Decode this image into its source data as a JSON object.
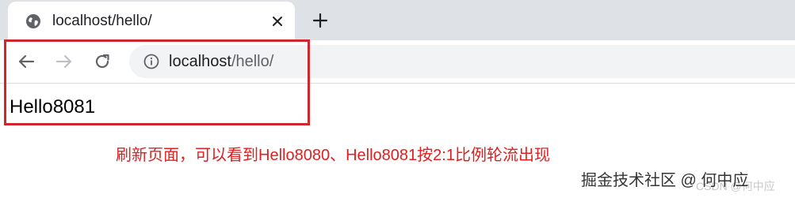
{
  "tab": {
    "title": "localhost/hello/",
    "favicon": "globe-icon",
    "close_icon": "close-icon"
  },
  "new_tab_icon": "plus-icon",
  "toolbar": {
    "back_icon": "arrow-left-icon",
    "forward_icon": "arrow-right-icon",
    "reload_icon": "reload-icon",
    "site_info_icon": "info-circle-icon",
    "url_host": "localhost",
    "url_path": "/hello/"
  },
  "page": {
    "body_text": "Hello8081"
  },
  "annotation": {
    "text": "刷新页面，可以看到Hello8080、Hello8081按2:1比例轮流出现",
    "color": "#e02020",
    "box_color": "#d0262c"
  },
  "watermark": {
    "main": "掘金技术社区 @ 何中应",
    "faint": "CSDN @何中应"
  }
}
